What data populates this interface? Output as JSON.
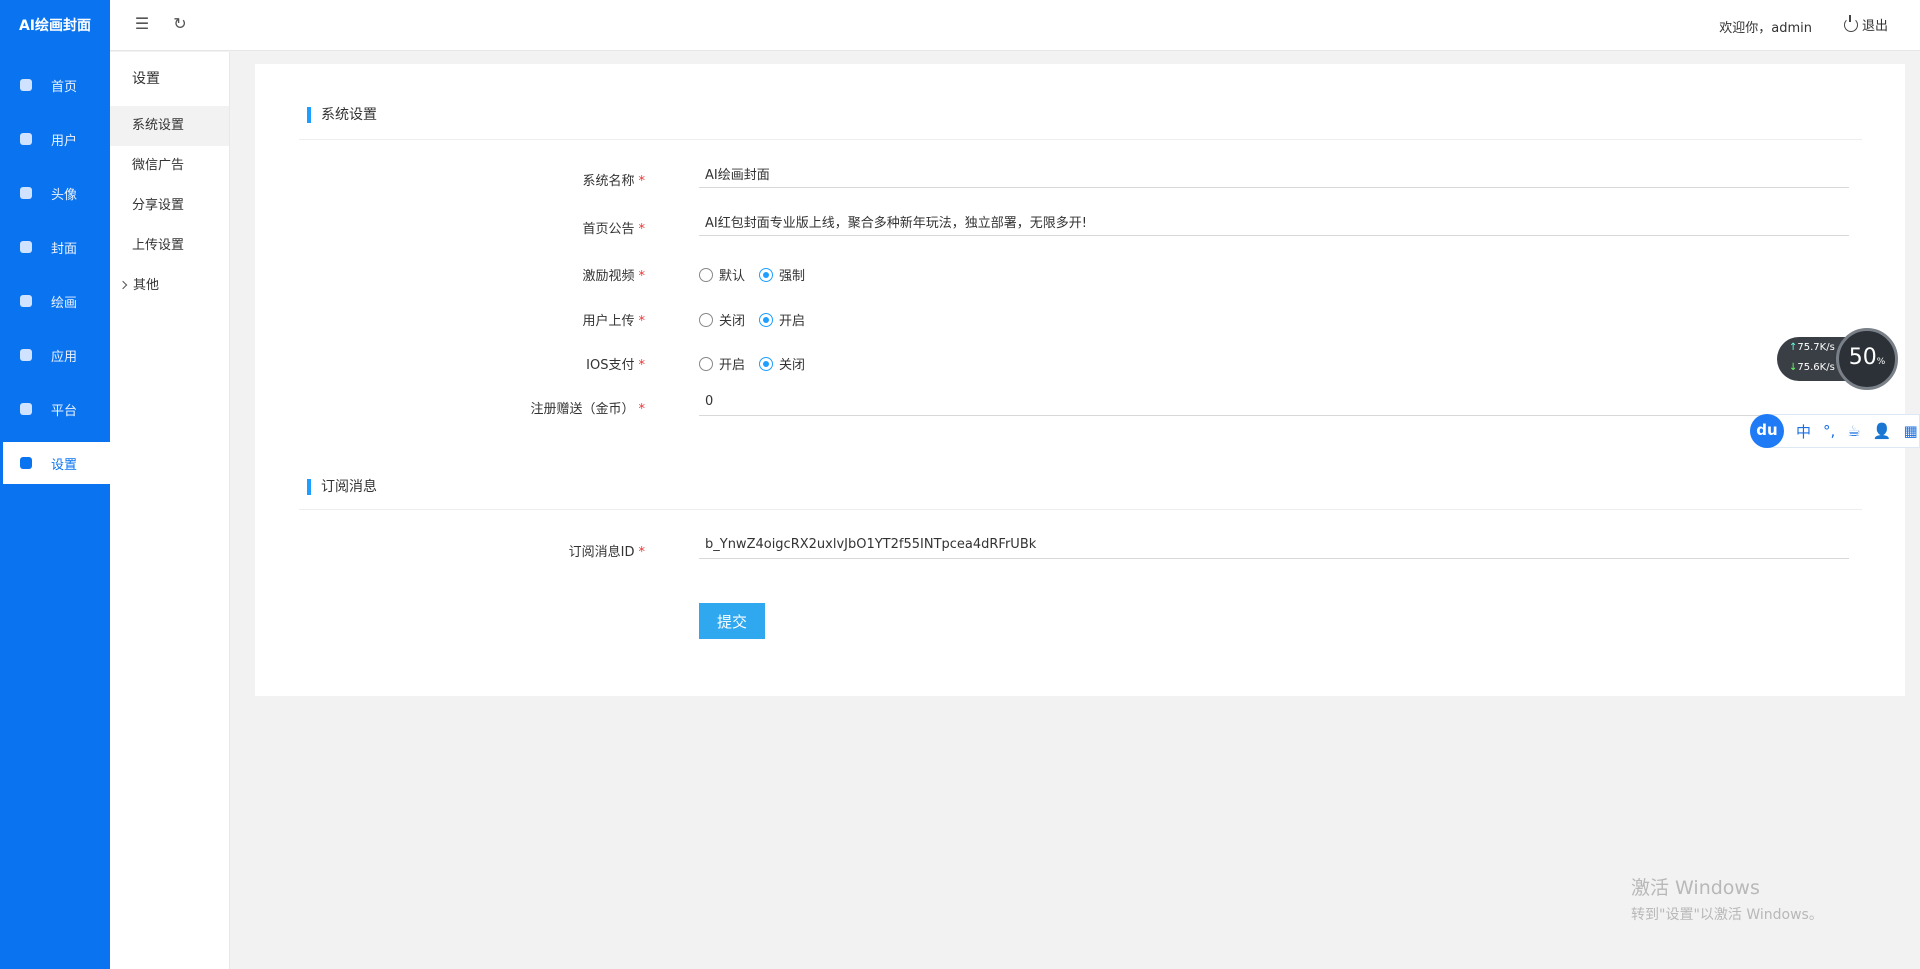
{
  "brand": "AI绘画封面",
  "nav": [
    {
      "label": "首页",
      "icon": "home-icon"
    },
    {
      "label": "用户",
      "icon": "diamond-icon"
    },
    {
      "label": "头像",
      "icon": "avatar-icon"
    },
    {
      "label": "封面",
      "icon": "cover-icon"
    },
    {
      "label": "绘画",
      "icon": "image-icon"
    },
    {
      "label": "应用",
      "icon": "app-icon"
    },
    {
      "label": "平台",
      "icon": "platform-icon"
    },
    {
      "label": "设置",
      "icon": "settings-icon",
      "active": true
    }
  ],
  "header": {
    "welcome": "欢迎你，admin",
    "logout": "退出"
  },
  "subnav": {
    "title": "设置",
    "items": [
      "系统设置",
      "微信广告",
      "分享设置",
      "上传设置",
      "其他"
    ]
  },
  "form": {
    "section1": "系统设置",
    "section2": "订阅消息",
    "fields": {
      "system_name": {
        "label": "系统名称",
        "value": "AI绘画封面"
      },
      "notice": {
        "label": "首页公告",
        "value": "AI红包封面专业版上线，聚合多种新年玩法，独立部署，无限多开!"
      },
      "reward_video": {
        "label": "激励视频",
        "options": [
          "默认",
          "强制"
        ],
        "selected": "强制"
      },
      "user_upload": {
        "label": "用户上传",
        "options": [
          "关闭",
          "开启"
        ],
        "selected": "开启"
      },
      "ios_pay": {
        "label": "IOS支付",
        "options": [
          "开启",
          "关闭"
        ],
        "selected": "关闭"
      },
      "register_gift": {
        "label": "注册赠送（金币）",
        "value": "0"
      },
      "subscribe_id": {
        "label": "订阅消息ID",
        "value": "b_YnwZ4oigcRX2uxlvJbO1YT2f55INTpcea4dRFrUBk"
      }
    },
    "required_mark": "*",
    "submit": "提交"
  },
  "netmon": {
    "up": "75.7",
    "down": "75.6",
    "unit": "K/s",
    "gauge": "50",
    "gauge_unit": "%"
  },
  "ime": {
    "logo": "du",
    "lang": "中",
    "punct": "°,"
  },
  "activation": {
    "line1": "激活 Windows",
    "line2": "转到\"设置\"以激活 Windows。"
  },
  "colors": {
    "primary": "#0a74f0",
    "accent": "#1e9fff",
    "required": "#e33333"
  }
}
